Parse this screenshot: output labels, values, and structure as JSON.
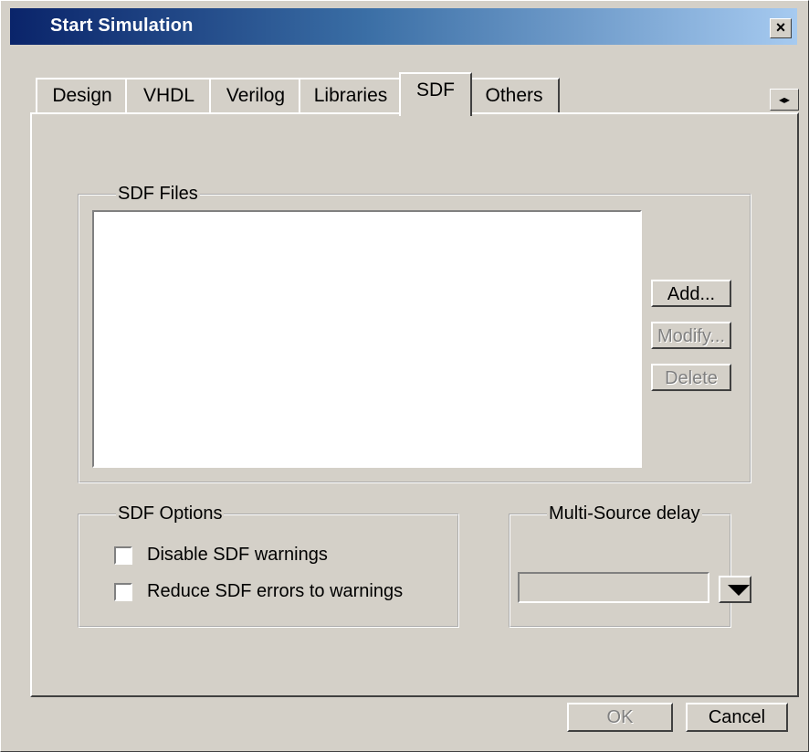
{
  "window": {
    "title": "Start Simulation",
    "close_label": "×"
  },
  "tabs": [
    {
      "label": "Design",
      "active": false
    },
    {
      "label": "VHDL",
      "active": false
    },
    {
      "label": "Verilog",
      "active": false
    },
    {
      "label": "Libraries",
      "active": false
    },
    {
      "label": "SDF",
      "active": true
    },
    {
      "label": "Others",
      "active": false
    }
  ],
  "tab_scroll": {
    "label": "◂▸"
  },
  "sdf_files": {
    "legend": "SDF Files",
    "files": [],
    "buttons": {
      "add": "Add...",
      "modify": "Modify...",
      "delete": "Delete"
    }
  },
  "sdf_options": {
    "legend": "SDF Options",
    "checkboxes": [
      {
        "label": "Disable SDF warnings",
        "checked": false
      },
      {
        "label": "Reduce SDF errors to warnings",
        "checked": false
      }
    ]
  },
  "multi_source_delay": {
    "legend": "Multi-Source delay",
    "value": ""
  },
  "footer": {
    "ok_label": "OK",
    "cancel_label": "Cancel"
  }
}
